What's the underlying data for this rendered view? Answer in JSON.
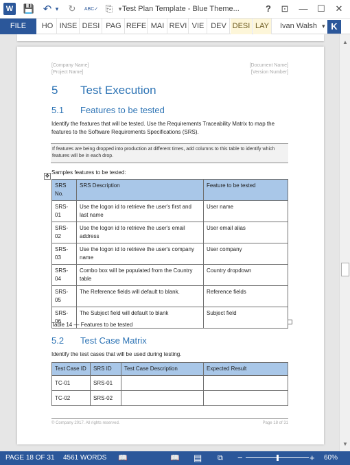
{
  "window": {
    "title": "Test Plan Template - Blue Theme...",
    "help": "?",
    "restore_ribbon": "⊡",
    "minimize": "—",
    "maximize": "☐",
    "close": "✕"
  },
  "qat": {
    "app_icon": "W",
    "save": "💾",
    "undo": "↶",
    "undo_dropdown": "▾",
    "redo": "↻",
    "spelling": "ABC✓",
    "format_painter": "⎘",
    "customize": "▾"
  },
  "ribbon": {
    "file_label": "FILE",
    "tabs": [
      "HO",
      "INSE",
      "DESI",
      "PAG",
      "REFE",
      "MAI",
      "REVI",
      "VIE",
      "DEV"
    ],
    "contextual_tabs": [
      "DESI",
      "LAY"
    ],
    "user_name": "Ivan Walsh",
    "user_dropdown": "▾",
    "user_initial": "K"
  },
  "document": {
    "header": {
      "company": "[Company Name]",
      "project": "[Project Name]",
      "document": "[Document Name]",
      "version": "[Version Number]"
    },
    "section": {
      "number": "5",
      "title": "Test Execution"
    },
    "subsection1": {
      "number": "5.1",
      "title": "Features to be tested"
    },
    "intro_text": "Identify the features that will be tested. Use the Requirements Traceability Matrix to map the features to the Software Requirements Specifications (SRS).",
    "note_text": "If features are being dropped into production at different times, add columns to this table to identify which features will be in each drop.",
    "samples_label": "Samples features to be tested:",
    "features_table": {
      "headers": [
        "SRS No.",
        "SRS Description",
        "Feature to be tested"
      ],
      "rows": [
        [
          "SRS-01",
          "Use the logon id to retrieve the user's first and last name",
          "User name"
        ],
        [
          "SRS-02",
          "Use the logon id to retrieve the user's email address",
          "User email alias"
        ],
        [
          "SRS-03",
          "Use the logon id to retrieve the user's company name",
          "User  company"
        ],
        [
          "SRS-04",
          "Combo box will be populated from the Country table",
          "Country dropdown"
        ],
        [
          "SRS-05",
          "The Reference fields will default to blank.",
          "Reference fields"
        ],
        [
          "SRS-06",
          "The Subject field will default to blank",
          "Subject field"
        ]
      ]
    },
    "table_caption": "Table 14 — Features to be tested",
    "subsection2": {
      "number": "5.2",
      "title": "Test Case Matrix"
    },
    "test_cases_text": "Identify the test cases that will be used during testing.",
    "test_case_table": {
      "headers": [
        "Test Case ID",
        "SRS ID",
        "Test Case Description",
        "Expected Result"
      ],
      "rows": [
        [
          "TC-01",
          "SRS-01",
          "",
          ""
        ],
        [
          "TC-02",
          "SRS-02",
          "",
          ""
        ]
      ]
    },
    "footer": {
      "left": "© Company 2017. All rights reserved.",
      "right": "Page 18 of 31"
    }
  },
  "status": {
    "page": "PAGE 18 OF 31",
    "words": "4561 WORDS",
    "proofing_icon": "📖",
    "read_mode_icon": "📖",
    "print_layout_icon": "▤",
    "web_layout_icon": "⧉",
    "zoom_out": "−",
    "zoom_in": "+",
    "zoom": "60%",
    "zoom_level_percent": 60
  },
  "scrollbar": {
    "up": "▲",
    "down": "▼",
    "scroll_fraction": 0.55
  }
}
